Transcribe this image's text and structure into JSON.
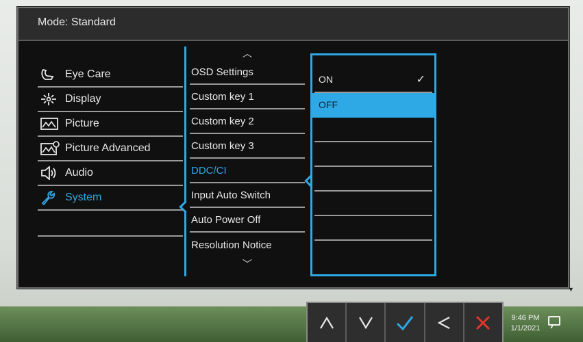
{
  "osd": {
    "title": "Mode: Standard",
    "left_menu": [
      {
        "label": "Eye Care",
        "icon": "eye-care-icon",
        "selected": false
      },
      {
        "label": "Display",
        "icon": "display-icon",
        "selected": false
      },
      {
        "label": "Picture",
        "icon": "picture-icon",
        "selected": false
      },
      {
        "label": "Picture Advanced",
        "icon": "picture-advanced-icon",
        "selected": false
      },
      {
        "label": "Audio",
        "icon": "speaker-icon",
        "selected": false
      },
      {
        "label": "System",
        "icon": "wrench-icon",
        "selected": true
      }
    ],
    "middle_menu": [
      {
        "label": "OSD Settings",
        "selected": false
      },
      {
        "label": "Custom key 1",
        "selected": false
      },
      {
        "label": "Custom key 2",
        "selected": false
      },
      {
        "label": "Custom key 3",
        "selected": false
      },
      {
        "label": "DDC/CI",
        "selected": true
      },
      {
        "label": "Input Auto Switch",
        "selected": false
      },
      {
        "label": "Auto Power Off",
        "selected": false
      },
      {
        "label": "Resolution Notice",
        "selected": false
      }
    ],
    "options": [
      {
        "label": "ON",
        "checked": true,
        "highlighted": false
      },
      {
        "label": "OFF",
        "checked": false,
        "highlighted": true
      }
    ],
    "check_mark": "✓",
    "accent_color": "#2fa8e6"
  },
  "controls": [
    {
      "name": "up-button",
      "icon": "up-arrow-icon"
    },
    {
      "name": "down-button",
      "icon": "down-arrow-icon"
    },
    {
      "name": "ok-button",
      "icon": "check-icon"
    },
    {
      "name": "back-button",
      "icon": "left-arrow-icon"
    },
    {
      "name": "exit-button",
      "icon": "close-icon"
    }
  ],
  "taskbar": {
    "time": "9:46 PM",
    "date": "1/1/2021"
  }
}
